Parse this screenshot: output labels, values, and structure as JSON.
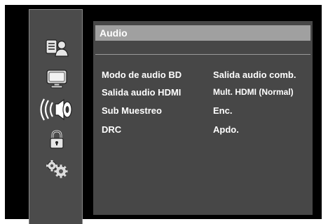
{
  "menu": {
    "title": "Audio",
    "settings": [
      {
        "label": "Modo de audio BD",
        "value": "Salida audio comb."
      },
      {
        "label": "Salida audio HDMI",
        "value": "Mult. HDMI (Normal)"
      },
      {
        "label": "Sub Muestreo",
        "value": "Enc."
      },
      {
        "label": "DRC",
        "value": "Apdo."
      }
    ]
  },
  "sidebar": {
    "items": [
      {
        "icon": "language-person-icon",
        "selected": false
      },
      {
        "icon": "display-monitor-icon",
        "selected": false
      },
      {
        "icon": "speaker-sound-icon",
        "selected": true
      },
      {
        "icon": "padlock-icon",
        "selected": false
      },
      {
        "icon": "gears-icon",
        "selected": false
      }
    ]
  },
  "colors": {
    "background": "#000000",
    "sidebar": "#4b4b4b",
    "panel": "#474747",
    "title_bar": "#a0a0a0",
    "text": "#ffffff"
  }
}
